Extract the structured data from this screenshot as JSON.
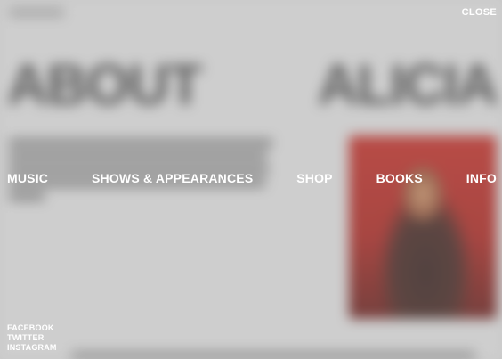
{
  "background": {
    "heading_left": "ABOUT",
    "heading_right": "ALICIA"
  },
  "overlay": {
    "close_label": "CLOSE",
    "nav": [
      {
        "label": "MUSIC"
      },
      {
        "label": "SHOWS & APPEARANCES"
      },
      {
        "label": "SHOP"
      },
      {
        "label": "BOOKS"
      },
      {
        "label": "INFO"
      }
    ],
    "social": [
      {
        "label": "FACEBOOK"
      },
      {
        "label": "TWITTER"
      },
      {
        "label": "INSTAGRAM"
      }
    ]
  },
  "colors": {
    "overlay_text": "#ffffff",
    "photo_accent": "#b2211a"
  }
}
